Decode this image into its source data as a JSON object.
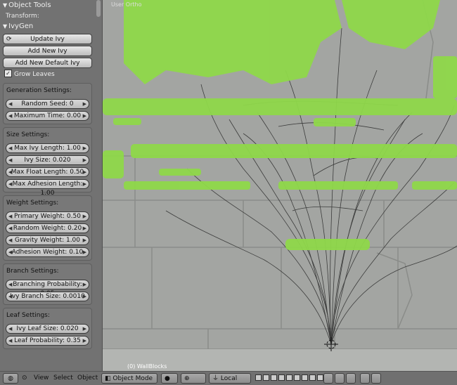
{
  "panel": {
    "title": "Object Tools",
    "transform_label": "Transform:",
    "section_title": "IvyGen",
    "buttons": {
      "update": "Update Ivy",
      "add_new": "Add New Ivy",
      "add_default": "Add New Default Ivy"
    },
    "grow_leaves": "Grow Leaves",
    "generation": {
      "title": "Generation Settings:",
      "random_seed": "Random Seed: 0",
      "max_time": "Maximum Time: 0.00"
    },
    "size": {
      "title": "Size Settings:",
      "max_ivy_length": "Max Ivy Length: 1.00",
      "ivy_size": "Ivy Size: 0.020",
      "max_float_length": "Max Float Length: 0.50",
      "max_adhesion_length": "Max Adhesion Length: 1.00"
    },
    "weight": {
      "title": "Weight Settings:",
      "primary": "Primary Weight: 0.50",
      "random": "Random Weight: 0.20",
      "gravity": "Gravity Weight: 1.00",
      "adhesion": "Adhesion Weight: 0.10"
    },
    "branch": {
      "title": "Branch Settings:",
      "probability": "Branching Probability: 0.05",
      "size": "Ivy Branch Size: 0.0010"
    },
    "leaf": {
      "title": "Leaf Settings:",
      "size": "Ivy Leaf Size: 0.020",
      "probability": "Leaf Probability: 0.35"
    }
  },
  "viewport": {
    "label": "User Ortho",
    "object_name": "(0) WallBlocks",
    "colors": {
      "wall": "#a3a5a2",
      "ivy_leaf": "#8fd84a",
      "branch": "#2a2a2a"
    }
  },
  "bottom_bar": {
    "menu": [
      "View",
      "Select",
      "Object"
    ],
    "mode": "Object Mode",
    "pivot": "Local"
  }
}
